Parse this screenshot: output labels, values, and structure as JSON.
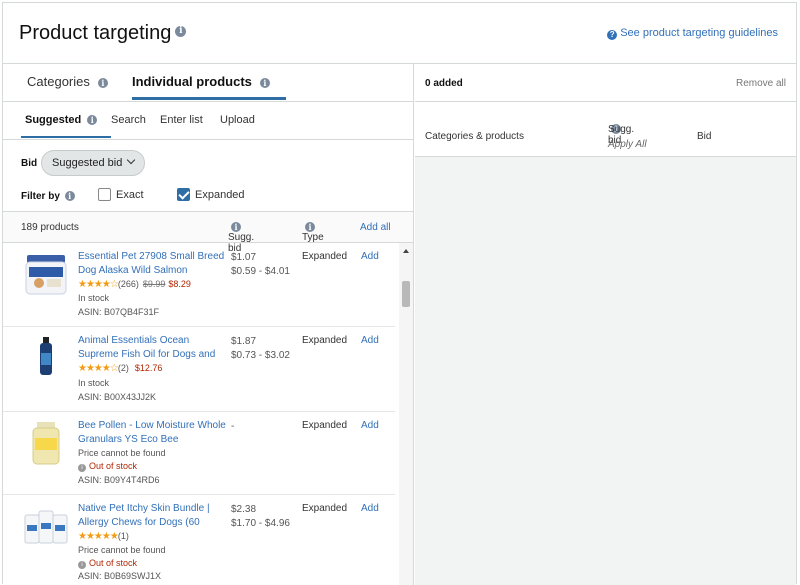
{
  "header": {
    "title": "Product targeting",
    "guidelines_link": "See product targeting guidelines"
  },
  "tabs": {
    "categories": "Categories",
    "individual": "Individual products"
  },
  "subtabs": {
    "suggested": "Suggested",
    "search": "Search",
    "enter_list": "Enter list",
    "upload": "Upload"
  },
  "bid": {
    "label": "Bid",
    "value": "Suggested bid"
  },
  "filter": {
    "label": "Filter by",
    "exact": "Exact",
    "expanded": "Expanded",
    "exact_checked": false,
    "expanded_checked": true
  },
  "list_header": {
    "count": "189 products",
    "sugg_bid": "Sugg. bid",
    "type": "Type",
    "add_all": "Add all"
  },
  "products": [
    {
      "name": "Essential Pet 27908 Small Breed Dog Alaska Wild Salmon",
      "stars": "★★★★☆",
      "reviews": "(266)",
      "list_price": "$9.99",
      "price": "$8.29",
      "status": "In stock",
      "asin": "ASIN: B07QB4F31F",
      "bid": "$1.07",
      "bid_range": "$0.59 - $4.01",
      "type": "Expanded",
      "add": "Add"
    },
    {
      "name": "Animal Essentials Ocean Supreme Fish Oil for Dogs and",
      "stars": "★★★★☆",
      "reviews": "(2)",
      "list_price": "",
      "price": "$12.76",
      "status": "In stock",
      "asin": "ASIN: B00X43JJ2K",
      "bid": "$1.87",
      "bid_range": "$0.73 - $3.02",
      "type": "Expanded",
      "add": "Add"
    },
    {
      "name": "Bee Pollen - Low Moisture Whole Granulars YS Eco Bee",
      "price_note": "Price cannot be found",
      "status": "Out of stock",
      "asin": "ASIN: B09Y4T4RD6",
      "bid": "-",
      "type": "Expanded",
      "add": "Add"
    },
    {
      "name": "Native Pet Itchy Skin Bundle | Allergy Chews for Dogs (60",
      "stars": "★★★★★",
      "reviews": "(1)",
      "price_note": "Price cannot be found",
      "status": "Out of stock",
      "asin": "ASIN: B0B69SWJ1X",
      "bid": "$2.38",
      "bid_range": "$1.70 - $4.96",
      "type": "Expanded",
      "add": "Add"
    }
  ],
  "right_panel": {
    "added": "0 added",
    "remove_all": "Remove all",
    "col_categories": "Categories & products",
    "col_sugg_bid": "Sugg. bid",
    "apply_all": "Apply All",
    "col_bid": "Bid"
  },
  "colors": {
    "link": "#3270b8",
    "accent": "#2f6ea5",
    "price": "#b12704",
    "star": "#f39c12"
  }
}
